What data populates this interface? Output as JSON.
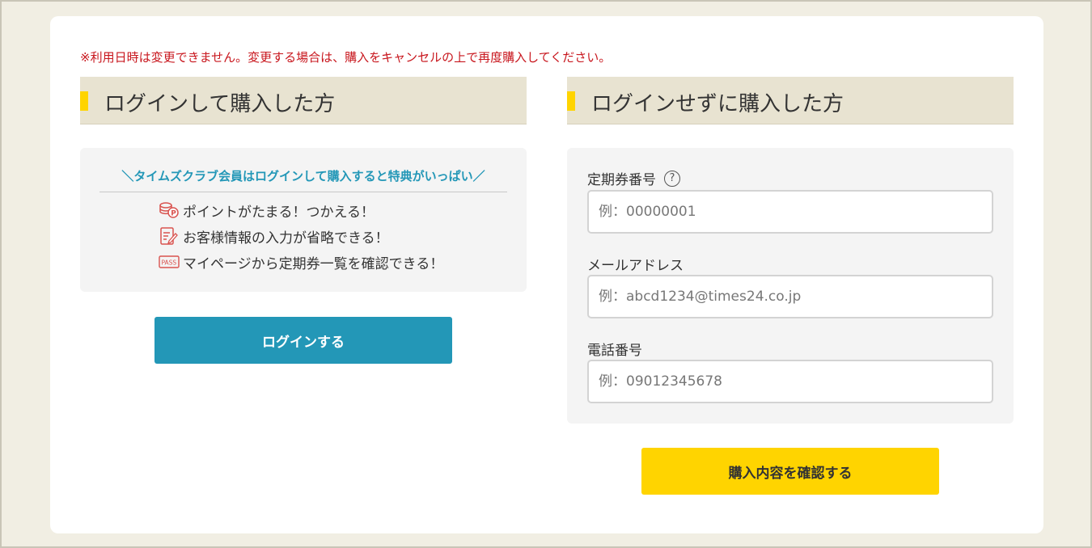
{
  "notice": "※利用日時は変更できません。変更する場合は、購入をキャンセルの上で再度購入してください。",
  "left_section": {
    "title": "ログインして購入した方",
    "benefits_title": "＼タイムズクラブ会員はログインして購入すると特典がいっぱい／",
    "benefits": [
      {
        "icon": "coin-points-icon",
        "label": "ポイントがたまる！つかえる！"
      },
      {
        "icon": "form-edit-icon",
        "label": "お客様情報の入力が省略できる！"
      },
      {
        "icon": "pass-icon",
        "label": "マイページから定期券一覧を確認できる！"
      }
    ],
    "pass_icon_text": "PASS",
    "login_button": "ログインする"
  },
  "right_section": {
    "title": "ログインせずに購入した方",
    "fields": [
      {
        "label": "定期券番号",
        "placeholder": "例：00000001",
        "value": ""
      },
      {
        "label": "メールアドレス",
        "placeholder": "例：abcd1234@times24.co.jp",
        "value": ""
      },
      {
        "label": "電話番号",
        "placeholder": "例：09012345678",
        "value": ""
      }
    ],
    "help_icon_glyph": "?",
    "confirm_button": "購入内容を確認する"
  },
  "colors": {
    "accent_blue": "#2397b7",
    "accent_yellow": "#ffd400",
    "notice_red": "#c8161d",
    "heading_bg": "#e8e3d1"
  }
}
